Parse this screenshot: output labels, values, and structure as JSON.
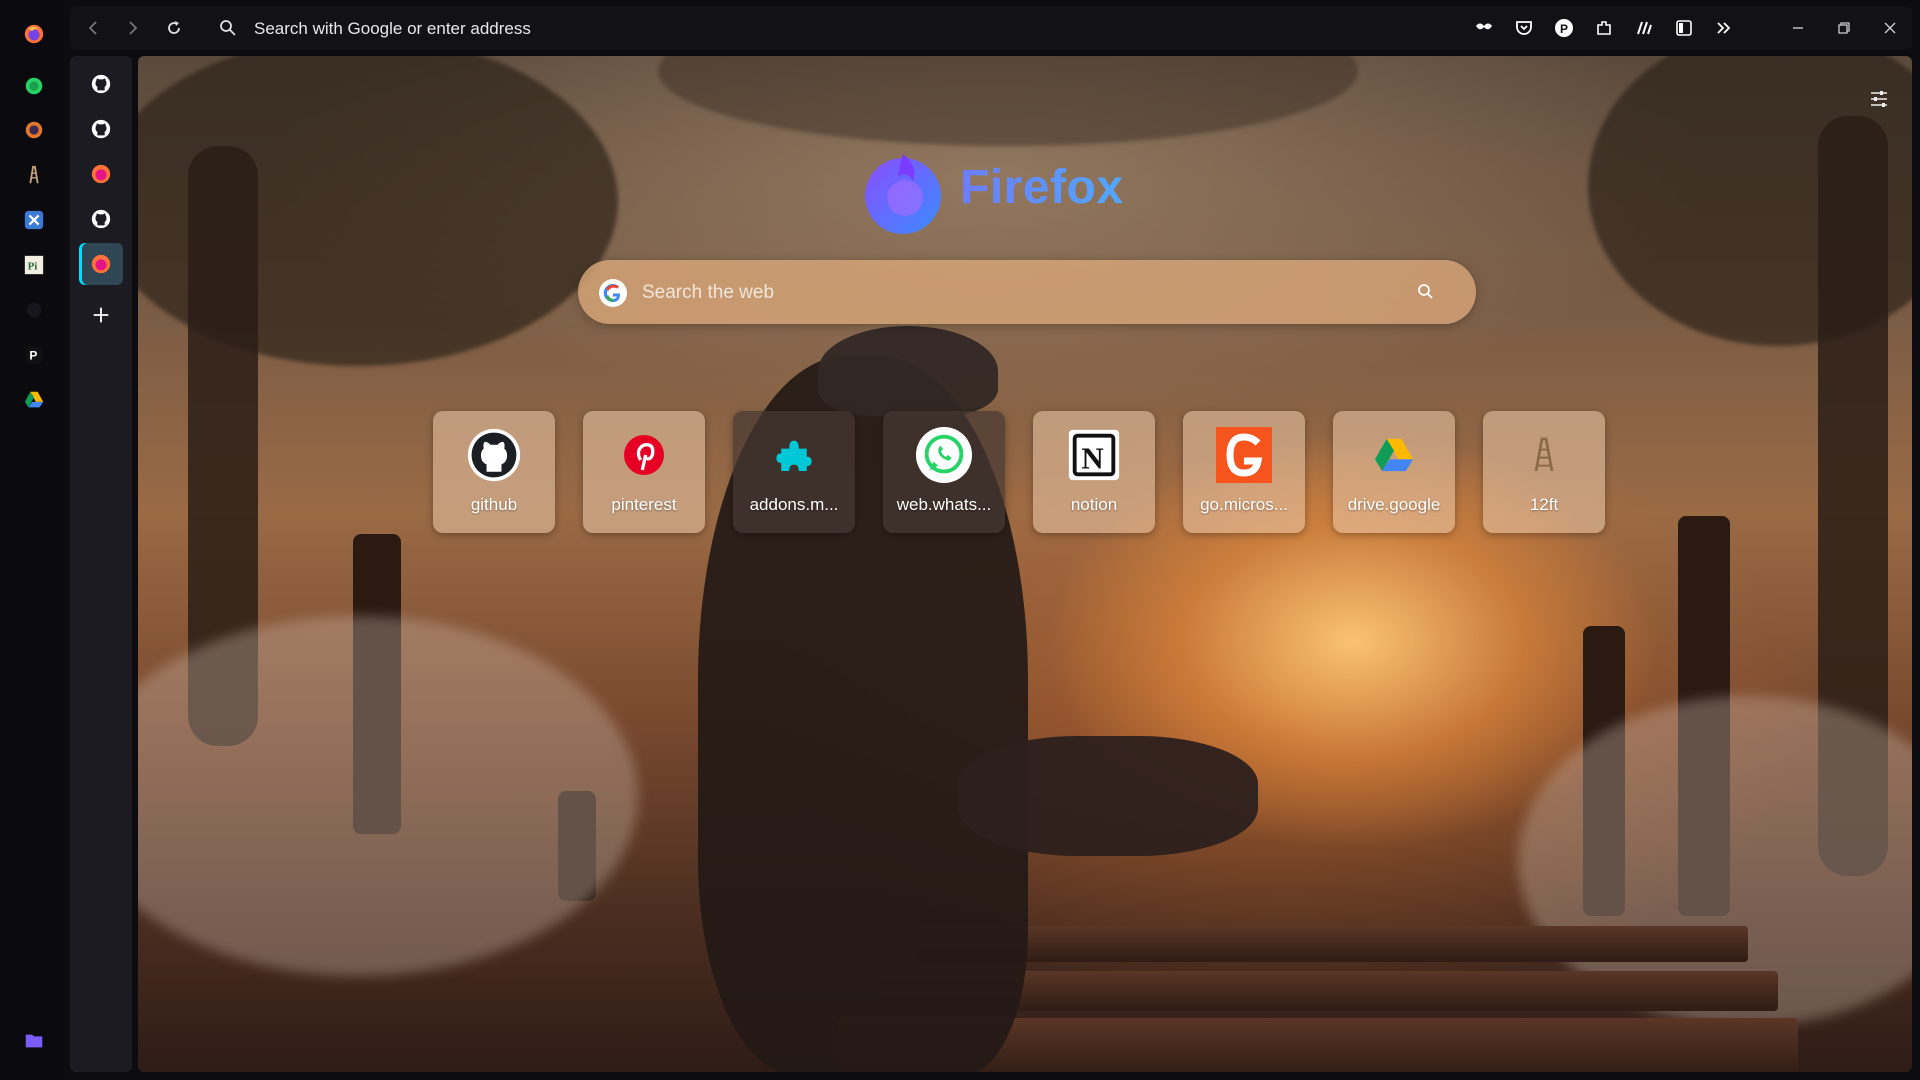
{
  "toolbar": {
    "url_placeholder": "Search with Google or enter address"
  },
  "app_sidebar": {
    "icons": [
      "firefox-icon",
      "whatsapp-icon",
      "circle-app-icon",
      "12ft-icon",
      "tools-app-icon",
      "pi-app-icon",
      "dark-app-icon",
      "p-app-icon",
      "drive-icon",
      "folder-icon"
    ]
  },
  "tabs": {
    "items": [
      "github-tab",
      "github-tab",
      "firefox-tab",
      "github-tab",
      "firefox-newtab-tab"
    ],
    "active_index": 4
  },
  "newtab": {
    "brand": "Firefox",
    "search_placeholder": "Search the web",
    "shortcuts": [
      {
        "label": "github",
        "icon": "github-icon"
      },
      {
        "label": "pinterest",
        "icon": "pinterest-icon"
      },
      {
        "label": "addons.m...",
        "icon": "addons-icon"
      },
      {
        "label": "web.whats...",
        "icon": "whatsapp-icon"
      },
      {
        "label": "notion",
        "icon": "notion-icon"
      },
      {
        "label": "go.micros...",
        "icon": "microsoft-go-icon"
      },
      {
        "label": "drive.google",
        "icon": "drive-icon"
      },
      {
        "label": "12ft",
        "icon": "12ft-icon"
      }
    ]
  },
  "colors": {
    "accent": "#00ddff",
    "brand_gradient_start": "#6c7dff",
    "brand_gradient_end": "#52a8ff"
  }
}
